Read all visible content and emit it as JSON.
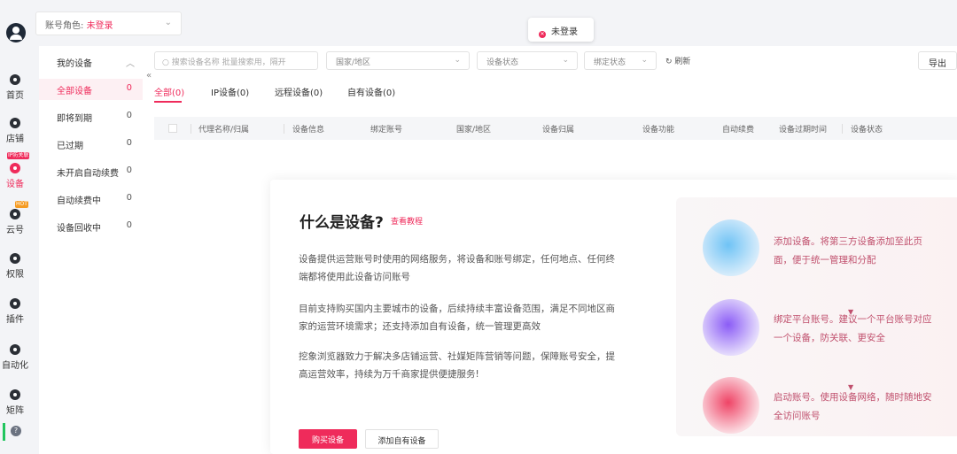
{
  "sidebar": {
    "items": [
      {
        "label": "首页",
        "icon": "home-icon"
      },
      {
        "label": "店铺",
        "icon": "store-icon"
      },
      {
        "label": "设备",
        "icon": "device-icon",
        "badge": "IP防关联"
      },
      {
        "label": "云号",
        "icon": "cloud-number-icon",
        "badge": "HOT"
      },
      {
        "label": "权限",
        "icon": "permission-icon"
      },
      {
        "label": "插件",
        "icon": "plugin-icon"
      },
      {
        "label": "自动化",
        "icon": "automation-icon"
      },
      {
        "label": "矩阵",
        "icon": "matrix-icon"
      }
    ]
  },
  "topbar": {
    "role_label": "账号角色:",
    "role_value": "未登录"
  },
  "toast": {
    "text": "未登录"
  },
  "devices_menu": {
    "title": "我的设备",
    "items": [
      {
        "label": "全部设备",
        "count": "0"
      },
      {
        "label": "即将到期",
        "count": "0"
      },
      {
        "label": "已过期",
        "count": "0"
      },
      {
        "label": "未开启自动续费",
        "count": "0"
      },
      {
        "label": "自动续费中",
        "count": "0"
      },
      {
        "label": "设备回收中",
        "count": "0"
      }
    ]
  },
  "toolbar": {
    "search_placeholder": "搜索设备名称 批量搜索用，隔开",
    "country_placeholder": "国家/地区",
    "status_placeholder": "设备状态",
    "bind_placeholder": "绑定状态",
    "refresh": "刷新",
    "export": "导出"
  },
  "tabs": [
    {
      "label": "全部(0)"
    },
    {
      "label": "IP设备(0)"
    },
    {
      "label": "远程设备(0)"
    },
    {
      "label": "自有设备(0)"
    }
  ],
  "table": {
    "columns": [
      "代理名称/归属",
      "设备信息",
      "绑定账号",
      "国家/地区",
      "设备归属",
      "设备功能",
      "自动续费",
      "设备过期时间",
      "设备状态"
    ]
  },
  "empty": {
    "title": "什么是设备?",
    "tutorial": "查看教程",
    "paragraphs": [
      "设备提供运营账号时使用的网络服务，将设备和账号绑定，任何地点、任何终端都将使用此设备访问账号",
      "目前支持购买国内主要城市的设备，后续持续丰富设备范围，满足不同地区商家的运营环境需求；还支持添加自有设备，统一管理更高效",
      "挖象浏览器致力于解决多店铺运营、社媒矩阵营销等问题，保障账号安全，提高运营效率，持续为万千商家提供便捷服务!"
    ],
    "buy": "购买设备",
    "add_own": "添加自有设备",
    "steps": [
      {
        "text": "添加设备。将第三方设备添加至此页面，便于统一管理和分配"
      },
      {
        "text": "绑定平台账号。建议一个平台账号对应一个设备，防关联、更安全"
      },
      {
        "text": "启动账号。使用设备网络，随时随地安全访问账号"
      }
    ]
  },
  "colors": {
    "accent": "#ef2b5b"
  }
}
